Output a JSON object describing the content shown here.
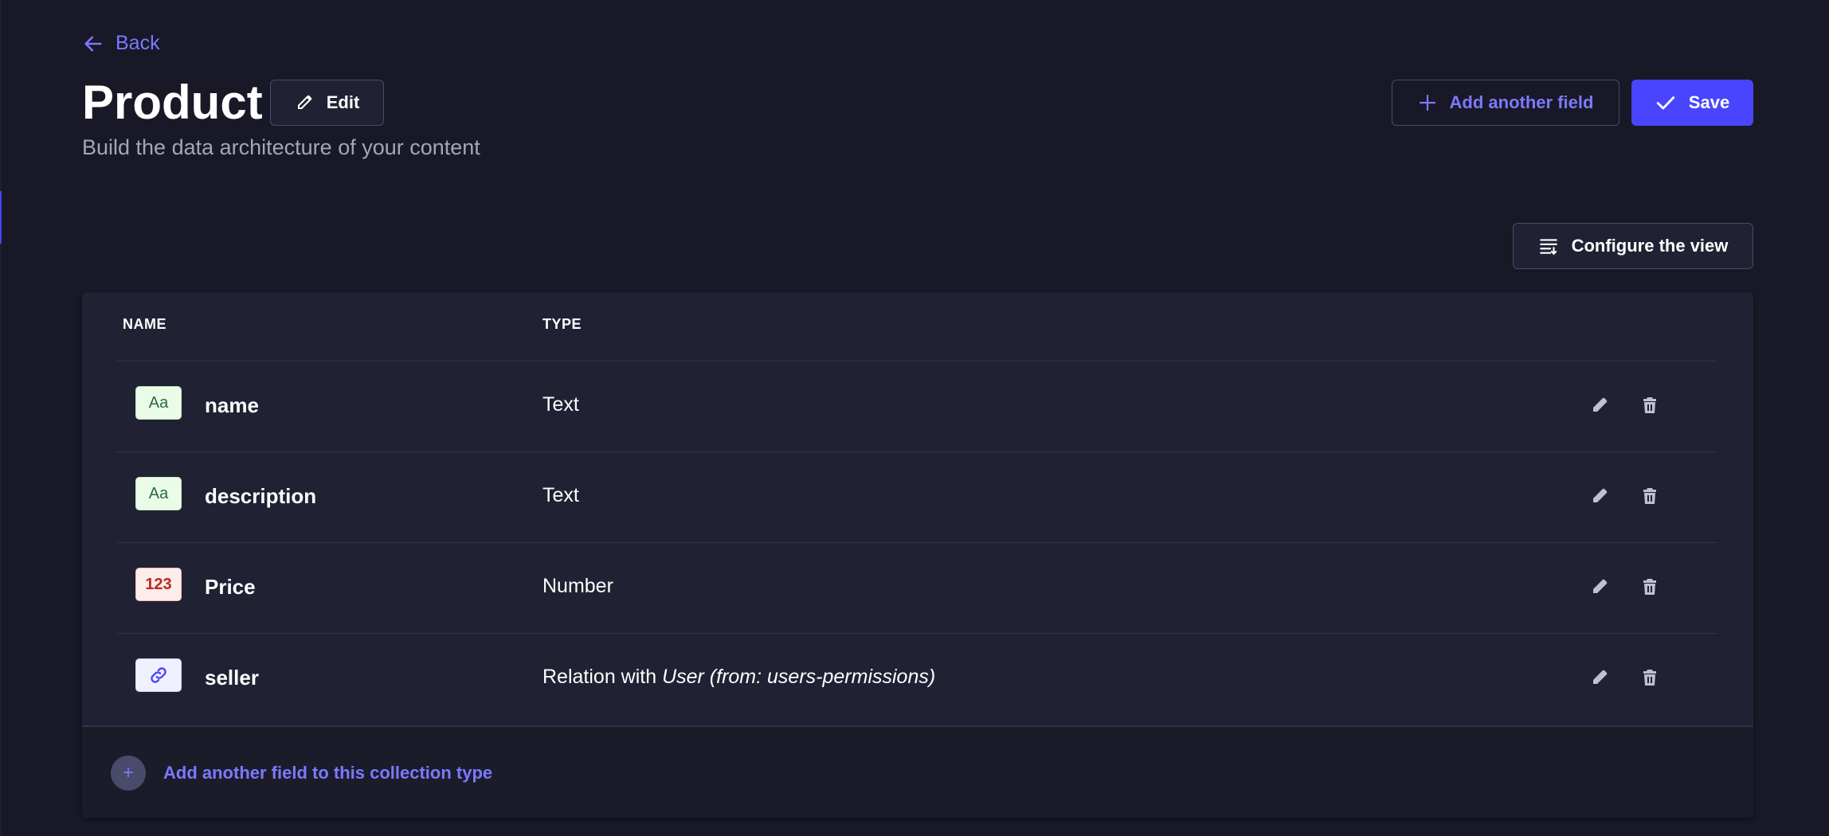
{
  "header": {
    "back_label": "Back",
    "title": "Product",
    "edit_label": "Edit",
    "subtitle": "Build the data architecture of your content",
    "add_field_label": "Add another field",
    "save_label": "Save"
  },
  "toolbar": {
    "configure_label": "Configure the view"
  },
  "table": {
    "columns": [
      "NAME",
      "TYPE"
    ],
    "rows": [
      {
        "icon": "text-field-icon",
        "icon_text": "Aa",
        "name": "name",
        "type": "Text",
        "type_detail": ""
      },
      {
        "icon": "text-field-icon",
        "icon_text": "Aa",
        "name": "description",
        "type": "Text",
        "type_detail": ""
      },
      {
        "icon": "number-field-icon",
        "icon_text": "123",
        "name": "Price",
        "type": "Number",
        "type_detail": ""
      },
      {
        "icon": "relation-field-icon",
        "icon_text": "",
        "name": "seller",
        "type": "Relation with ",
        "type_detail": "User (from: users-permissions)"
      }
    ],
    "footer_add_label": "Add another field to this collection type"
  },
  "colors": {
    "background": "#181826",
    "card": "#212134",
    "primary": "#4945ff",
    "primary_text": "#7b79ff",
    "muted_text": "#a5a5ba"
  }
}
